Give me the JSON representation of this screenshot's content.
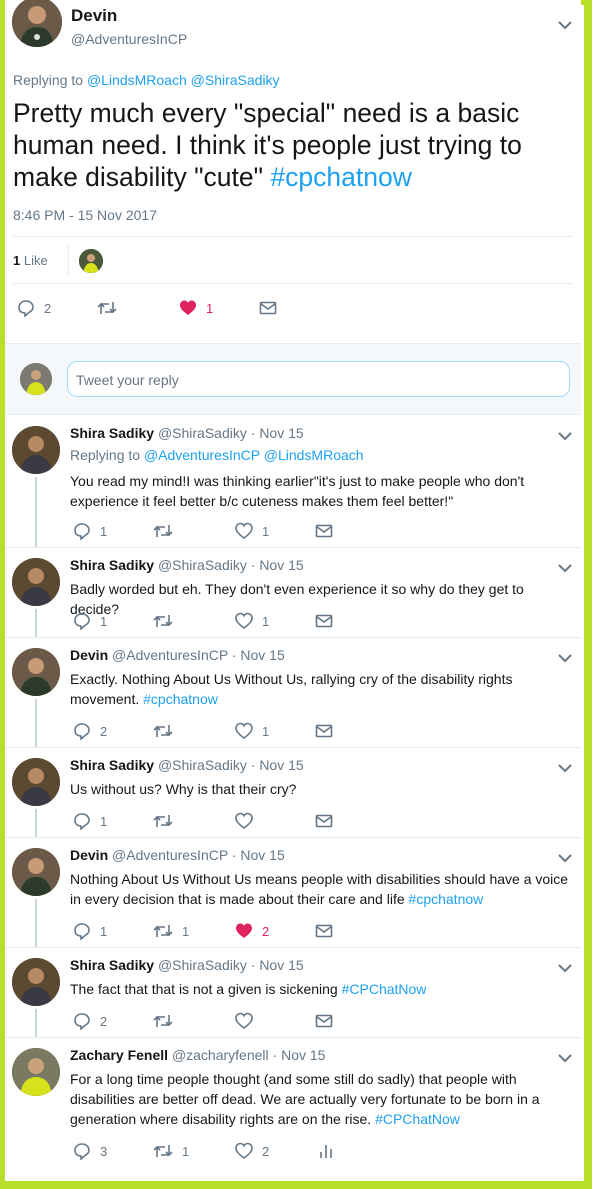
{
  "main_tweet": {
    "name": "Devin",
    "handle": "@AdventuresInCP",
    "replying_prefix": "Replying to",
    "replying_to": [
      "@LindsMRoach",
      "@ShiraSadiky"
    ],
    "text": "Pretty much every \"special\" need is a basic human need. I think it's people just trying to make disability \"cute\"",
    "hashtag": "#cpchatnow",
    "timestamp": "8:46 PM - 15 Nov 2017",
    "likes_count": "1",
    "likes_label": "Like",
    "actions": {
      "replies": "2",
      "retweets": "",
      "likes": "1",
      "liked": true
    }
  },
  "reply_box": {
    "placeholder": "Tweet your reply"
  },
  "replies": [
    {
      "name": "Shira Sadiky",
      "handle": "@ShiraSadiky",
      "date": "Nov 15",
      "replying_prefix": "Replying to",
      "replying_to": [
        "@AdventuresInCP",
        "@LindsMRoach"
      ],
      "text": "You read my mind!I was thinking earlier\"it's just to make people who don't experience it feel better  b/c cuteness  makes them feel better!\"",
      "hashtag": "",
      "replies": "1",
      "retweets": "",
      "likes": "1",
      "liked": false
    },
    {
      "name": "Shira Sadiky",
      "handle": "@ShiraSadiky",
      "date": "Nov 15",
      "text": "Badly worded but eh. They don't even experience it so why do they get to decide?",
      "hashtag": "",
      "replies": "1",
      "retweets": "",
      "likes": "1",
      "liked": false
    },
    {
      "name": "Devin",
      "handle": "@AdventuresInCP",
      "date": "Nov 15",
      "text": "Exactly. Nothing About Us Without Us, rallying cry of the disability rights movement.",
      "hashtag": "#cpchatnow",
      "replies": "2",
      "retweets": "",
      "likes": "1",
      "liked": false
    },
    {
      "name": "Shira Sadiky",
      "handle": "@ShiraSadiky",
      "date": "Nov 15",
      "text": "Us without us? Why is that their cry?",
      "hashtag": "",
      "replies": "1",
      "retweets": "",
      "likes": "",
      "liked": false
    },
    {
      "name": "Devin",
      "handle": "@AdventuresInCP",
      "date": "Nov 15",
      "text": "Nothing About Us Without Us means people with disabilities should have a voice in every decision that is made about their care and life",
      "hashtag": "#cpchatnow",
      "replies": "1",
      "retweets": "1",
      "likes": "2",
      "liked": true
    },
    {
      "name": "Shira Sadiky",
      "handle": "@ShiraSadiky",
      "date": "Nov 15",
      "text": "The fact that that is not a given is sickening",
      "hashtag": "#CPChatNow",
      "replies": "2",
      "retweets": "",
      "likes": "",
      "liked": false
    },
    {
      "name": "Zachary Fenell",
      "handle": "@zacharyfenell",
      "date": "Nov 15",
      "text": "For a long time people thought (and some still do sadly) that people with disabilities are better off dead. We are actually very fortunate to be born in a generation where disability rights are on the rise.",
      "hashtag": "#CPChatNow",
      "replies": "3",
      "retweets": "1",
      "likes": "2",
      "liked": false
    }
  ],
  "colors": {
    "accent": "#1da1f2",
    "like": "#e0245e",
    "muted": "#657786",
    "frame": "#b8e02a"
  }
}
